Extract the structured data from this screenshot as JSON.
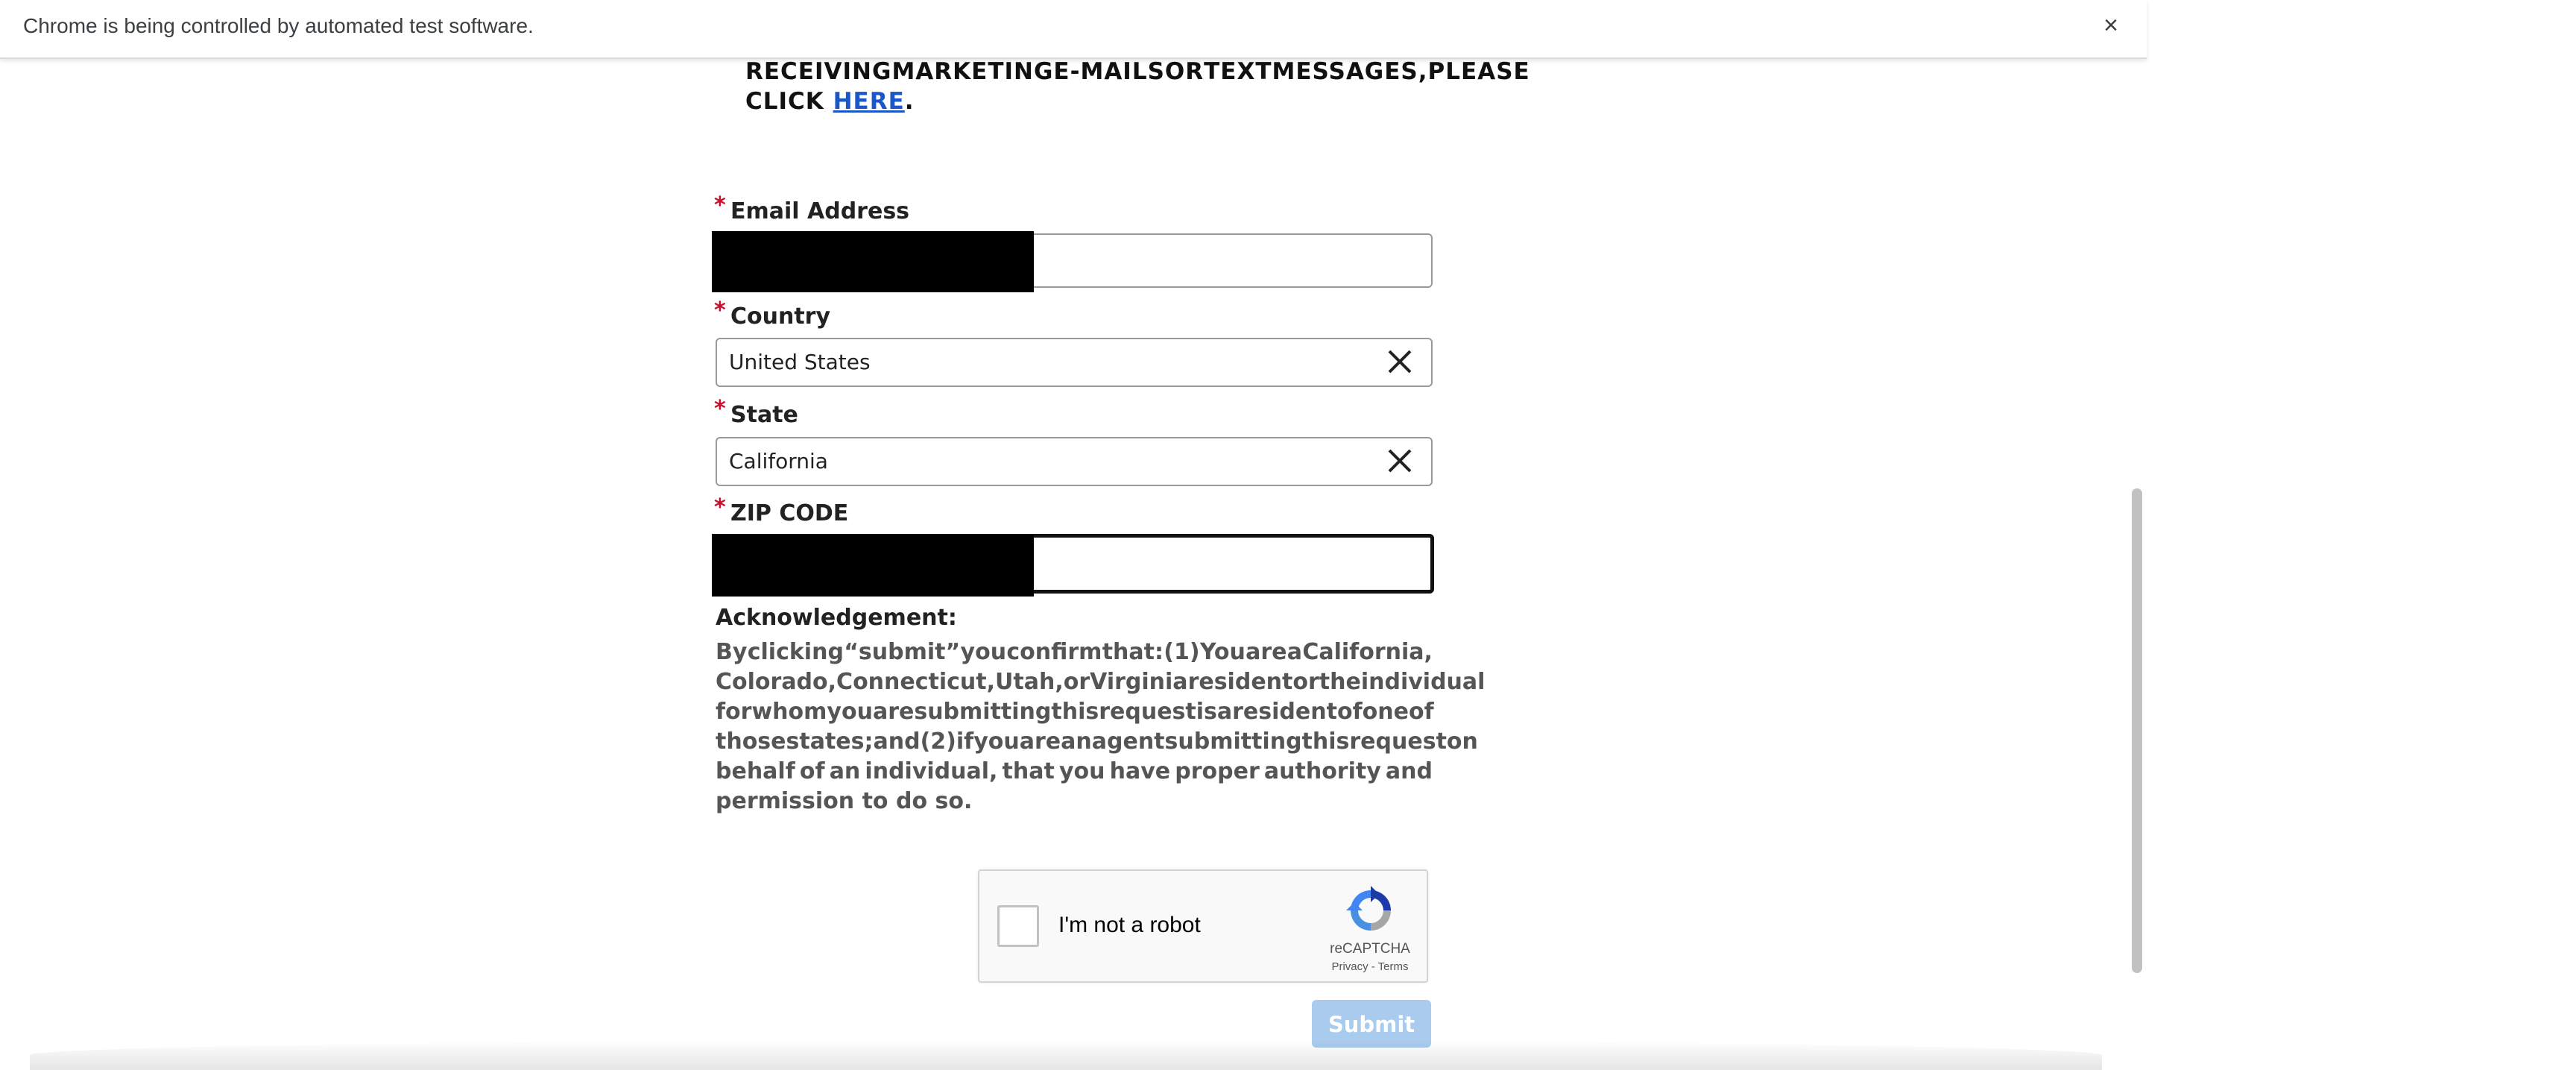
{
  "infobar": {
    "message": "Chrome is being controlled by automated test software.",
    "close_glyph": "×"
  },
  "notice": {
    "line1_words": [
      "RECEIVING",
      "MARKETING",
      "E-MAILS",
      "OR",
      "TEXT",
      "MESSAGES,",
      "PLEASE"
    ],
    "line2_prefix": "CLICK",
    "link": "HERE",
    "line2_suffix": "."
  },
  "form": {
    "required_mark": "*",
    "email": {
      "label": "Email Address",
      "value": ""
    },
    "country": {
      "label": "Country",
      "value": "United States"
    },
    "state": {
      "label": "State",
      "value": "California"
    },
    "zip": {
      "label": "ZIP CODE",
      "value": ""
    }
  },
  "acknowledgement": {
    "title": "Acknowledgement:",
    "lines": [
      "By clicking “submit” you confirm that: (1) You are a California,",
      "Colorado, Connecticut, Utah, or Virginia resident or the individual",
      "for whom you are submitting this request is a resident of one of",
      "those states; and (2) if you are an agent submitting this request on",
      "behalf of an individual, that you have proper authority and",
      "permission to do so."
    ]
  },
  "captcha": {
    "label": "I'm not a robot",
    "brand": "reCAPTCHA",
    "links": "Privacy - Terms"
  },
  "submit_label": "Submit",
  "colors": {
    "link": "#1a57c9",
    "required": "#c8102e",
    "submit_bg": "#a9cbed",
    "scroll_thumb": "#c1c1c1"
  }
}
